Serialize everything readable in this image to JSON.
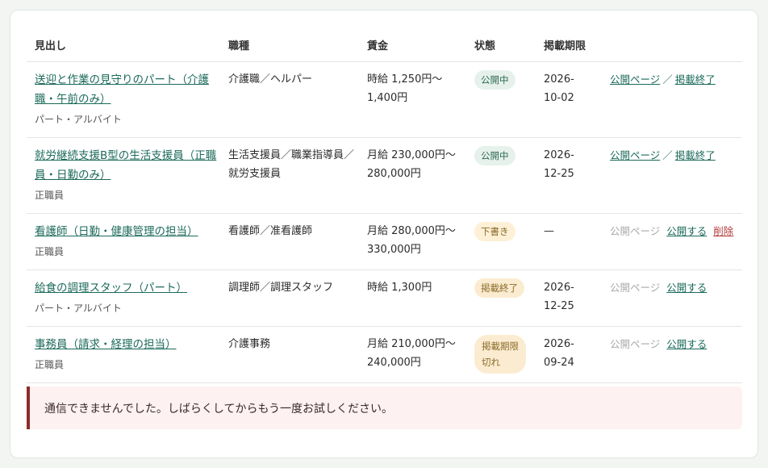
{
  "headers": {
    "title": "見出し",
    "job_type": "職種",
    "wage": "賃金",
    "status": "状態",
    "deadline": "掲載期限"
  },
  "rows": [
    {
      "title": "送迎と作業の見守りのパート（介護職・午前のみ）",
      "employment": "パート・アルバイト",
      "job_type": "介護職／ヘルパー",
      "wage": "時給 1,250円〜1,400円",
      "status": "公開中",
      "deadline": "2026-10-02",
      "actions": [
        "公開ページ",
        "掲載終了"
      ]
    },
    {
      "title": "就労継続支援B型の生活支援員（正職員・日勤のみ）",
      "employment": "正職員",
      "job_type": "生活支援員／職業指導員／就労支援員",
      "wage": "月給 230,000円〜280,000円",
      "status": "公開中",
      "deadline": "2026-12-25",
      "actions": [
        "公開ページ",
        "掲載終了"
      ]
    },
    {
      "title": "看護師（日勤・健康管理の担当）",
      "employment": "正職員",
      "job_type": "看護師／准看護師",
      "wage": "月給 280,000円〜330,000円",
      "status": "下書き",
      "deadline": "—",
      "actions": [
        "公開ページ",
        "公開する",
        "削除"
      ]
    },
    {
      "title": "給食の調理スタッフ（パート）",
      "employment": "パート・アルバイト",
      "job_type": "調理師／調理スタッフ",
      "wage": "時給 1,300円",
      "status": "掲載終了",
      "deadline": "2026-12-25",
      "actions": [
        "公開ページ",
        "公開する"
      ]
    },
    {
      "title": "事務員（請求・経理の担当）",
      "employment": "正職員",
      "job_type": "介護事務",
      "wage": "月給 210,000円〜240,000円",
      "status": "掲載期限切れ",
      "deadline": "2026-09-24",
      "actions": [
        "公開ページ",
        "公開する"
      ]
    }
  ],
  "alert": {
    "message": "通信できませんでした。しばらくしてからもう一度お試しください。"
  },
  "colors": {
    "link": "#1b6a5a",
    "danger": "#b33a3a",
    "alert_border": "#8d2b2b",
    "alert_bg": "#fdf1f1",
    "badge_open_bg": "#e7f1ec",
    "badge_warn_bg": "#fbecd1"
  }
}
